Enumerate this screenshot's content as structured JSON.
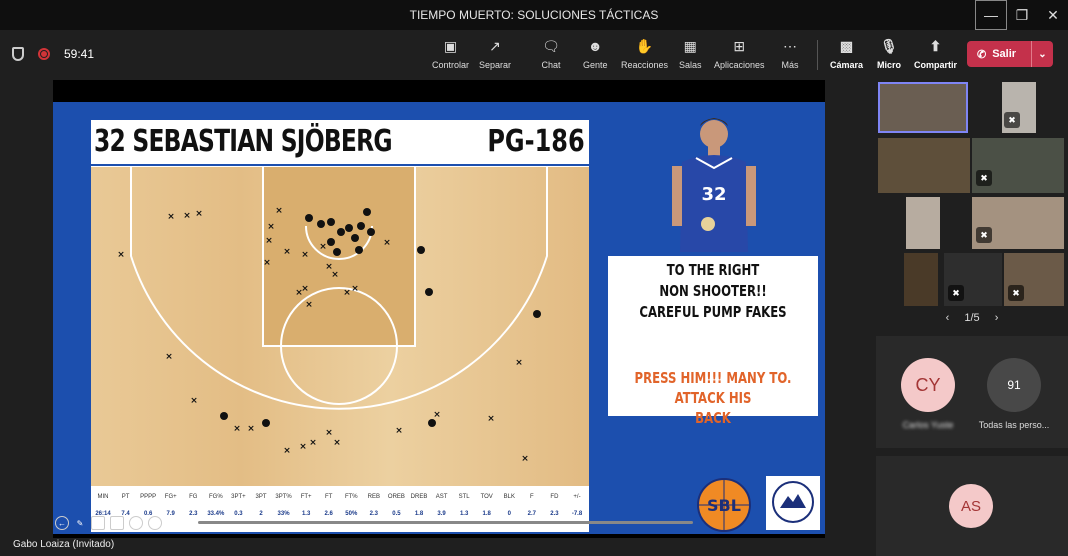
{
  "window": {
    "title": "TIEMPO MUERTO: SOLUCIONES TÁCTICAS"
  },
  "toolbar": {
    "timer": "59:41",
    "buttons": [
      {
        "label": "Controlar",
        "icon": "control-icon"
      },
      {
        "label": "Separar",
        "icon": "popout-icon"
      },
      {
        "label": "Chat",
        "icon": "chat-icon"
      },
      {
        "label": "Gente",
        "icon": "people-icon"
      },
      {
        "label": "Reacciones",
        "icon": "reactions-icon"
      },
      {
        "label": "Salas",
        "icon": "rooms-icon"
      },
      {
        "label": "Aplicaciones",
        "icon": "apps-icon"
      },
      {
        "label": "Más",
        "icon": "more-icon"
      },
      {
        "label": "Cámara",
        "icon": "camera-off-icon"
      },
      {
        "label": "Micro",
        "icon": "mic-off-icon"
      },
      {
        "label": "Compartir",
        "icon": "share-icon"
      }
    ],
    "leave_label": "Salir"
  },
  "slide": {
    "player_name": "32 SEBASTIAN SJÖBERG",
    "position": "PG-186",
    "jersey_number": "32",
    "note_lines": [
      "TO THE RIGHT",
      "NON SHOOTER!!",
      "CAREFUL PUMP FAKES"
    ],
    "note_lines2": [
      "PRESS HIM!!! MANY TO. ATTACK HIS",
      "BACK"
    ],
    "logo_text": "SBL",
    "stats_headers": [
      "MIN",
      "PT",
      "PPPP",
      "FG+",
      "FG",
      "FG%",
      "3PT+",
      "3PT",
      "3PT%",
      "FT+",
      "FT",
      "FT%",
      "REB",
      "OREB",
      "DREB",
      "AST",
      "STL",
      "TOV",
      "BLK",
      "F",
      "FD",
      "+/-"
    ],
    "stats_values": [
      "26:14",
      "7.4",
      "0.6",
      "7.9",
      "2.3",
      "33.4%",
      "0.3",
      "2",
      "33%",
      "1.3",
      "2.6",
      "50%",
      "2.3",
      "0.5",
      "1.8",
      "3.9",
      "1.3",
      "1.8",
      "0",
      "2.7",
      "2.3",
      "-7.8"
    ],
    "accent_color": "#1c4fae",
    "note2_color": "#e1642a"
  },
  "presenter": "Gabo Loaiza (Invitado)",
  "gallery": {
    "pager": "1/5",
    "avatars": [
      {
        "initials": "CY",
        "caption": "Carlos Yuste"
      },
      {
        "initials": "91",
        "caption": "Todas las perso..."
      },
      {
        "initials": "AS",
        "caption": ""
      }
    ]
  }
}
